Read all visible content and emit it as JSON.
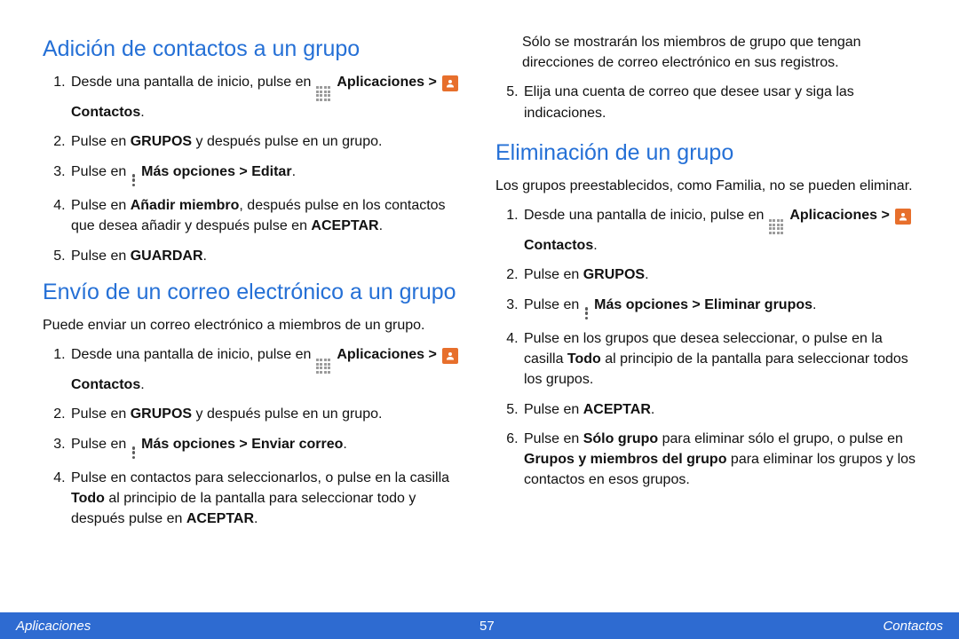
{
  "sections": {
    "add": {
      "title": "Adición de contactos a un grupo",
      "steps": {
        "s1a": "Desde una pantalla de inicio, pulse en ",
        "s1b": "Aplicaciones > ",
        "s1c": " Contactos",
        "s1d": ".",
        "s2a": "Pulse en ",
        "s2b": "GRUPOS",
        "s2c": " y después pulse en un grupo.",
        "s3a": "Pulse en ",
        "s3b": "Más opciones > Editar",
        "s3c": ".",
        "s4a": "Pulse en ",
        "s4b": "Añadir miembro",
        "s4c": ", después pulse en los contactos que desea añadir y después pulse en ",
        "s4d": "ACEPTAR",
        "s4e": ".",
        "s5a": "Pulse en ",
        "s5b": "GUARDAR",
        "s5c": "."
      }
    },
    "email": {
      "title": "Envío de un correo electrónico a un grupo",
      "lead": "Puede enviar un correo electrónico a miembros de un grupo.",
      "steps": {
        "s1a": "Desde una pantalla de inicio, pulse en ",
        "s1b": "Aplicaciones > ",
        "s1c": " Contactos",
        "s1d": ".",
        "s2a": "Pulse en ",
        "s2b": "GRUPOS",
        "s2c": " y después pulse en un grupo.",
        "s3a": "Pulse en ",
        "s3b": "Más opciones > Enviar correo",
        "s3c": ".",
        "s4a": "Pulse en contactos para seleccionarlos, o pulse en la casilla ",
        "s4b": "Todo",
        "s4c": " al principio de la pantalla para seleccionar todo y después pulse en ",
        "s4d": "ACEPTAR",
        "s4e": "."
      },
      "cont": {
        "note": "Sólo se mostrarán los miembros de grupo que tengan direcciones de correo electrónico en sus registros.",
        "s5": "Elija una cuenta de correo que desee usar y siga las indicaciones."
      }
    },
    "delete": {
      "title": "Eliminación de un grupo",
      "lead": "Los grupos preestablecidos, como Familia, no se pueden eliminar.",
      "steps": {
        "s1a": "Desde una pantalla de inicio, pulse en ",
        "s1b": "Aplicaciones > ",
        "s1c": " Contactos",
        "s1d": ".",
        "s2a": "Pulse en ",
        "s2b": "GRUPOS",
        "s2c": ".",
        "s3a": "Pulse en ",
        "s3b": "Más opciones > Eliminar grupos",
        "s3c": ".",
        "s4a": "Pulse en los grupos que desea seleccionar, o pulse en la casilla ",
        "s4b": "Todo",
        "s4c": " al principio de la pantalla para seleccionar todos los grupos.",
        "s5a": "Pulse en ",
        "s5b": "ACEPTAR",
        "s5c": ".",
        "s6a": "Pulse en ",
        "s6b": "Sólo grupo",
        "s6c": " para eliminar sólo el grupo, o pulse en ",
        "s6d": "Grupos y miembros del grupo",
        "s6e": " para eliminar los grupos y los contactos en esos grupos."
      }
    }
  },
  "footer": {
    "left": "Aplicaciones",
    "page": "57",
    "right": "Contactos"
  }
}
